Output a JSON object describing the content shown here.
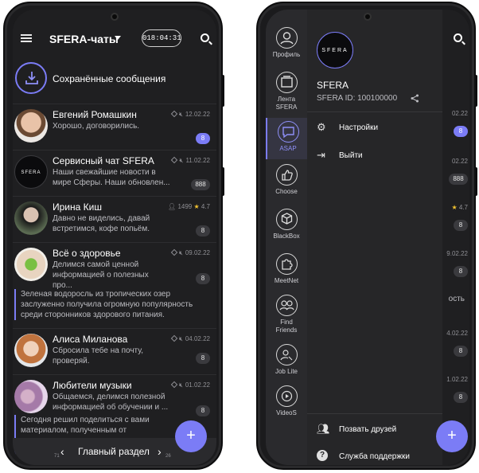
{
  "colors": {
    "accent": "#7b7cf6",
    "background": "#1f1f21",
    "text": "#ffffff",
    "muted": "#bdbdc2"
  },
  "header": {
    "menu_icon": "hamburger-icon",
    "title": "SFERA-чаты",
    "timer": "018:04:31",
    "search_icon": "search-icon"
  },
  "saved": {
    "label": "Сохранённые сообщения",
    "icon": "download-icon"
  },
  "chats": [
    {
      "name": "Евгений Ромашкин",
      "message": "Хорошо, договорились.",
      "date": "12.02.22",
      "badge": "8",
      "avatar": "man-portrait"
    },
    {
      "name": "Сервисный чат SFERA",
      "message": "Наши свежайшие новости в мире Сферы. Наши обновлен...",
      "date": "11.02.22",
      "badge": "888",
      "avatar": "sfera-logo",
      "avatar_text": "SFERA"
    },
    {
      "name": "Ирина Киш",
      "message": "Давно не виделись, давай встретимся, кофе попьём.",
      "members": "1499",
      "rating": "4.7",
      "badge": "8",
      "avatar": "woman-portrait"
    },
    {
      "name": "Всё о здоровье",
      "message": "Делимся самой ценной информацией о полезных про...",
      "date": "09.02.22",
      "badge": "8",
      "avatar": "hands-apple",
      "quote": "Зеленая водоросль из тропических озер заслуженно получила огромную популярность среди сторонников здорового питания."
    },
    {
      "name": "Алиса Миланова",
      "message": "Сбросила тебе на почту, проверяй.",
      "date": "04.02.22",
      "badge": "8",
      "avatar": "girl-portrait"
    },
    {
      "name": "Любители музыки",
      "message": "Общаемся, делимся полезной информацией об обучении и ...",
      "date": "01.02.22",
      "badge": "8",
      "avatar": "guitar-player",
      "quote": "Сегодня решил поделиться с вами материалом, полученным от влиятельного музыкального журнала Rolling Stone."
    }
  ],
  "bottom": {
    "label": "Главный раздел",
    "prev_num": "71",
    "next_num": "26",
    "fab": "+"
  },
  "rail": [
    {
      "label": "Профиль",
      "icon": "profile-icon"
    },
    {
      "label": "Лента SFERA",
      "icon": "feed-icon"
    },
    {
      "label": "ASAP",
      "icon": "chat-icon",
      "active": true
    },
    {
      "label": "Choose",
      "icon": "thumb-up-icon"
    },
    {
      "label": "BlackBox",
      "icon": "cube-icon"
    },
    {
      "label": "MeetNet",
      "icon": "puzzle-icon"
    },
    {
      "label": "Find Friends",
      "icon": "friends-icon"
    },
    {
      "label": "Job Lite",
      "icon": "job-icon"
    },
    {
      "label": "VideoS",
      "icon": "video-icon"
    }
  ],
  "drawer": {
    "logo_text": "SFERA",
    "name": "SFERA",
    "id": "SFERA ID: 100100000",
    "items": [
      {
        "label": "Настройки",
        "icon": "gear-icon"
      },
      {
        "label": "Выйти",
        "icon": "logout-icon"
      }
    ],
    "footer": [
      {
        "label": "Позвать друзей",
        "icon": "invite-icon"
      },
      {
        "label": "Служба поддержки",
        "icon": "help-icon"
      }
    ]
  },
  "behind": {
    "dates": [
      "02.22",
      "02.22",
      "4.7",
      "9.02.22",
      "ость",
      "4.02.22",
      "1.02.22"
    ],
    "badges": [
      "8",
      "888",
      "8",
      "8",
      "8",
      "8"
    ]
  }
}
